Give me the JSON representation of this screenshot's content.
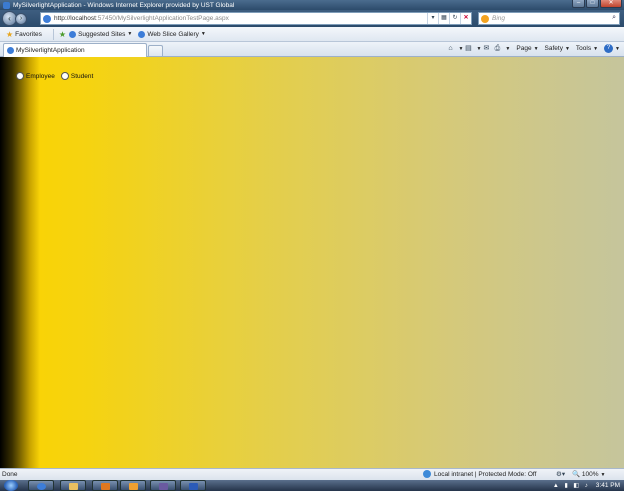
{
  "window": {
    "title": "MySilverlightApplication - Windows Internet Explorer provided by UST Global",
    "minimize": "–",
    "maximize": "□",
    "close": "✕"
  },
  "address_bar": {
    "url_host": "http://localhost",
    "url_rest": ":57450/MySilverlightApplicationTestPage.aspx",
    "search_placeholder": "Bing"
  },
  "favorites_bar": {
    "favorites_label": "Favorites",
    "items": [
      {
        "label": "Suggested Sites"
      },
      {
        "label": "Web Slice Gallery"
      }
    ]
  },
  "tab": {
    "label": "MySilverlightApplication"
  },
  "command_bar": {
    "page": "Page",
    "safety": "Safety",
    "tools": "Tools"
  },
  "content": {
    "radio_options": [
      {
        "label": "Employee"
      },
      {
        "label": "Student"
      }
    ],
    "background_colors": [
      "#000000",
      "#f9d307",
      "#c5c59c"
    ]
  },
  "status_bar": {
    "status": "Done",
    "zone": "Local intranet | Protected Mode: Off",
    "zoom": "100%"
  },
  "taskbar": {
    "clock": "3:41 PM"
  }
}
